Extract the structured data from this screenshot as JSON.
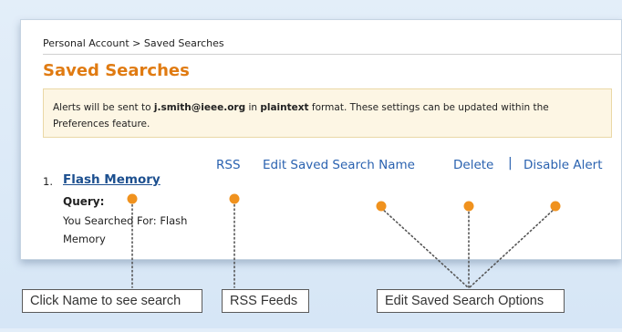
{
  "breadcrumb": "Personal Account > Saved Searches",
  "page_title": "Saved Searches",
  "alert": {
    "prefix": "Alerts will be sent to ",
    "email": "j.smith@ieee.org",
    "middle": " in ",
    "format": "plaintext",
    "suffix": " format. These settings can be updated within the Preferences feature."
  },
  "results": [
    {
      "number": "1.",
      "name": "Flash Memory",
      "query_label": "Query:",
      "searched_for": "You Searched For:  Flash Memory"
    }
  ],
  "actions": {
    "rss": "RSS",
    "edit_name": "Edit Saved Search Name",
    "delete": "Delete",
    "separator": "|",
    "disable_alert": "Disable Alert"
  },
  "callouts": {
    "name": "Click Name to see search",
    "rss": "RSS Feeds",
    "options": "Edit Saved Search Options"
  },
  "colors": {
    "title": "#e07b12",
    "link": "#2a62b0",
    "alert_bg": "#fdf6e4",
    "callout_dot": "#f0921e"
  }
}
